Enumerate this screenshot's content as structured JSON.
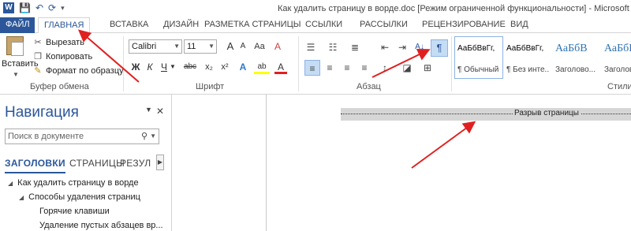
{
  "window": {
    "title": "Как удалить страницу в ворде.doc [Режим ограниченной функциональности] - Microsoft Word",
    "app_icon": "W"
  },
  "quick_access": {
    "save_icon": "💾",
    "undo_icon": "↶",
    "redo_icon": "⟳",
    "customize_icon": "▾"
  },
  "tabs": [
    "ФАЙЛ",
    "ГЛАВНАЯ",
    "ВСТАВКА",
    "ДИЗАЙН",
    "РАЗМЕТКА СТРАНИЦЫ",
    "ССЫЛКИ",
    "РАССЫЛКИ",
    "РЕЦЕНЗИРОВАНИЕ",
    "ВИД"
  ],
  "clipboard": {
    "paste_label": "Вставить",
    "cut": "Вырезать",
    "copy": "Копировать",
    "format_painter": "Формат по образцу",
    "group_label": "Буфер обмена"
  },
  "font": {
    "name": "Calibri",
    "size": "11",
    "group_label": "Шрифт",
    "bold": "Ж",
    "italic": "К",
    "underline": "Ч",
    "strike": "abc",
    "grow": "A",
    "shrink": "A",
    "case": "Aa",
    "clear": "A",
    "sub": "x₂",
    "sup": "x²",
    "effects": "A",
    "highlight": "ab",
    "color": "A"
  },
  "paragraph": {
    "group_label": "Абзац",
    "pilcrow": "¶",
    "sort": "A↓"
  },
  "styles": {
    "group_label": "Стили",
    "items": [
      {
        "sample": "АаБбВвГг,",
        "name": "¶ Обычный"
      },
      {
        "sample": "АаБбВвГг,",
        "name": "¶ Без инте..."
      },
      {
        "sample": "АаБбВ",
        "name": "Заголово..."
      },
      {
        "sample": "АаБбВ",
        "name": "Заголово"
      }
    ]
  },
  "navigation": {
    "title": "Навигация",
    "search_placeholder": "Поиск в документе",
    "tabs": [
      "ЗАГОЛОВКИ",
      "СТРАНИЦЫ",
      "РЕЗУЛ"
    ],
    "headings": [
      {
        "text": "Как удалить страницу в ворде",
        "level": 1
      },
      {
        "text": "Способы удаления страниц",
        "level": 2
      },
      {
        "text": "Горячие клавиши",
        "level": 3
      },
      {
        "text": "Удаление пустых абзацев вр...",
        "level": 3
      }
    ]
  },
  "document": {
    "page_break_label": "Разрыв страницы"
  },
  "colors": {
    "accent": "#2b579a",
    "annotation_arrow": "#e02020"
  }
}
